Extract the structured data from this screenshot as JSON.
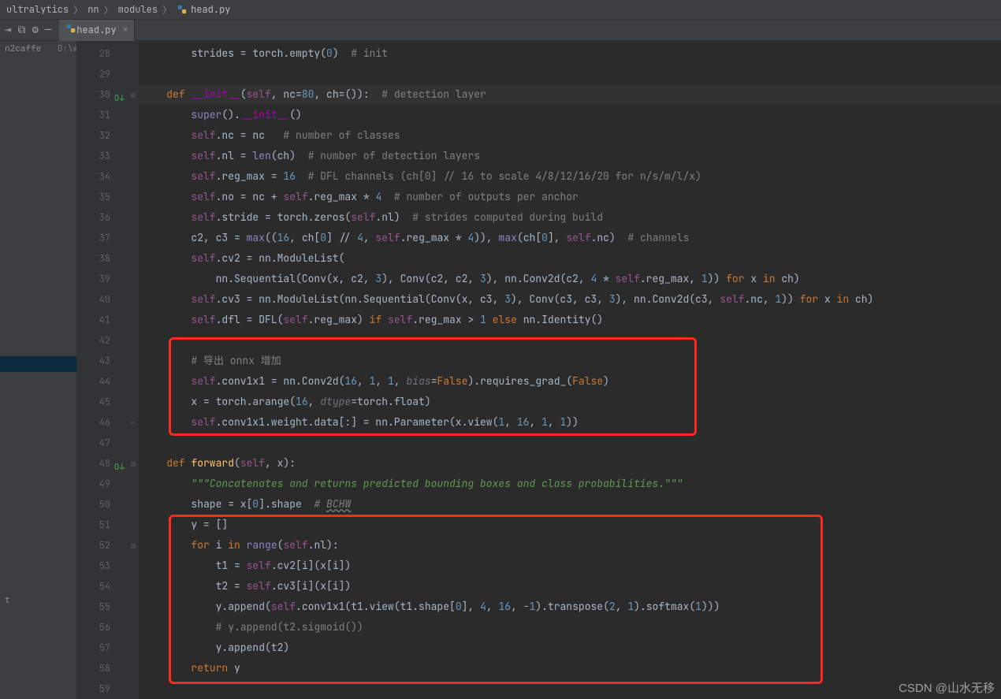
{
  "breadcrumb": {
    "p1": "ultralytics",
    "p2": "nn",
    "p3": "modules",
    "file": "head.py"
  },
  "tab": {
    "label": "head.py"
  },
  "sidebar": {
    "item0": "n2caffe",
    "item0path": "D:\\worksp",
    "item1": "t"
  },
  "lines": {
    "28": "28",
    "29": "29",
    "30": "30",
    "31": "31",
    "32": "32",
    "33": "33",
    "34": "34",
    "35": "35",
    "36": "36",
    "37": "37",
    "38": "38",
    "39": "39",
    "40": "40",
    "41": "41",
    "42": "42",
    "43": "43",
    "44": "44",
    "45": "45",
    "46": "46",
    "47": "47",
    "48": "48",
    "49": "49",
    "50": "50",
    "51": "51",
    "52": "52",
    "53": "53",
    "54": "54",
    "55": "55",
    "56": "56",
    "57": "57",
    "58": "58",
    "59": "59"
  },
  "code": {
    "l28_a": "        strides = torch.empty(",
    "l28_n": "0",
    "l28_b": ")  ",
    "l28_c": "# init",
    "l30_def": "    def ",
    "l30_fn": "__init__",
    "l30_a": "(",
    "l30_self": "self",
    "l30_b": ", nc=",
    "l30_n1": "80",
    "l30_c": ", ch=()):  ",
    "l30_cm": "# detection layer",
    "l31_a": "        ",
    "l31_b": "super",
    "l31_c": "().",
    "l31_d": "__init__",
    "l31_e": "()",
    "l32_a": "        ",
    "l32_self": "self",
    "l32_b": ".nc = nc   ",
    "l32_c": "# number of classes",
    "l33_a": "        ",
    "l33_self": "self",
    "l33_b": ".nl = ",
    "l33_len": "len",
    "l33_c": "(ch)  ",
    "l33_cm": "# number of detection layers",
    "l34_a": "        ",
    "l34_self": "self",
    "l34_b": ".reg_max = ",
    "l34_n": "16",
    "l34_c": "  ",
    "l34_cm": "# DFL channels (ch[0] // 16 to scale 4/8/12/16/20 for n/s/m/l/x)",
    "l35_a": "        ",
    "l35_self": "self",
    "l35_b": ".no = nc + ",
    "l35_self2": "self",
    "l35_c": ".reg_max * ",
    "l35_n": "4",
    "l35_d": "  ",
    "l35_cm": "# number of outputs per anchor",
    "l36_a": "        ",
    "l36_self": "self",
    "l36_b": ".stride = torch.zeros(",
    "l36_self2": "self",
    "l36_c": ".nl)  ",
    "l36_cm": "# strides computed during build",
    "l37_a": "        c2, c3 = ",
    "l37_max": "max",
    "l37_b": "((",
    "l37_n1": "16",
    "l37_c": ", ch[",
    "l37_n2": "0",
    "l37_d": "] // ",
    "l37_n3": "4",
    "l37_e": ", ",
    "l37_self": "self",
    "l37_f": ".reg_max * ",
    "l37_n4": "4",
    "l37_g": ")), ",
    "l37_max2": "max",
    "l37_h": "(ch[",
    "l37_n5": "0",
    "l37_i": "], ",
    "l37_self2": "self",
    "l37_j": ".nc)  ",
    "l37_cm": "# channels",
    "l38_a": "        ",
    "l38_self": "self",
    "l38_b": ".cv2 = nn.ModuleList(",
    "l39_a": "            nn.Sequential(Conv(x, c2, ",
    "l39_n1": "3",
    "l39_b": "), Conv(c2, c2, ",
    "l39_n2": "3",
    "l39_c": "), nn.Conv2d(c2, ",
    "l39_n3": "4",
    "l39_d": " * ",
    "l39_self": "self",
    "l39_e": ".reg_max, ",
    "l39_n4": "1",
    "l39_f": ")) ",
    "l39_for": "for ",
    "l39_g": "x ",
    "l39_in": "in ",
    "l39_h": "ch)",
    "l40_a": "        ",
    "l40_self": "self",
    "l40_b": ".cv3 = nn.ModuleList(nn.Sequential(Conv(x, c3, ",
    "l40_n1": "3",
    "l40_c": "), Conv(c3, c3, ",
    "l40_n2": "3",
    "l40_d": "), nn.Conv2d(c3, ",
    "l40_self2": "self",
    "l40_e": ".nc, ",
    "l40_n3": "1",
    "l40_f": ")) ",
    "l40_for": "for ",
    "l40_g": "x ",
    "l40_in": "in ",
    "l40_h": "ch)",
    "l41_a": "        ",
    "l41_self": "self",
    "l41_b": ".dfl = DFL(",
    "l41_self2": "self",
    "l41_c": ".reg_max) ",
    "l41_if": "if ",
    "l41_self3": "self",
    "l41_d": ".reg_max > ",
    "l41_n": "1",
    "l41_e": " ",
    "l41_else": "else ",
    "l41_f": "nn.Identity()",
    "l43_a": "        ",
    "l43_c": "# 导出 onnx 增加",
    "l44_a": "        ",
    "l44_self": "self",
    "l44_b": ".conv1x1 = nn.Conv2d(",
    "l44_n1": "16",
    "l44_c": ", ",
    "l44_n2": "1",
    "l44_d": ", ",
    "l44_n3": "1",
    "l44_e": ", ",
    "l44_kw": "bias",
    "l44_f": "=",
    "l44_false": "False",
    "l44_g": ").requires_grad_(",
    "l44_false2": "False",
    "l44_h": ")",
    "l45_a": "        x = torch.arange(",
    "l45_n": "16",
    "l45_b": ", ",
    "l45_kw": "dtype",
    "l45_c": "=torch.float)",
    "l46_a": "        ",
    "l46_self": "self",
    "l46_b": ".conv1x1.weight.data[:] = nn.Parameter(x.view(",
    "l46_n1": "1",
    "l46_c": ", ",
    "l46_n2": "16",
    "l46_d": ", ",
    "l46_n3": "1",
    "l46_e": ", ",
    "l46_n4": "1",
    "l46_f": "))",
    "l48_def": "    def ",
    "l48_fn": "forward",
    "l48_a": "(",
    "l48_self": "self",
    "l48_b": ", x):",
    "l49_a": "        ",
    "l49_doc": "\"\"\"Concatenates and returns predicted bounding boxes and class probabilities.\"\"\"",
    "l50_a": "        shape = x[",
    "l50_n": "0",
    "l50_b": "].shape  ",
    "l50_c": "# ",
    "l50_u": "BCHW",
    "l51_a": "        y = []",
    "l52_a": "        ",
    "l52_for": "for ",
    "l52_b": "i ",
    "l52_in": "in ",
    "l52_range": "range",
    "l52_c": "(",
    "l52_self": "self",
    "l52_d": ".nl):",
    "l53_a": "            t1 = ",
    "l53_self": "self",
    "l53_b": ".cv2[i](x[i])",
    "l54_a": "            t2 = ",
    "l54_self": "self",
    "l54_b": ".cv3[i](x[i])",
    "l55_a": "            y.append(",
    "l55_self": "self",
    "l55_b": ".conv1x1(t1.view(t1.shape[",
    "l55_n1": "0",
    "l55_c": "], ",
    "l55_n2": "4",
    "l55_d": ", ",
    "l55_n3": "16",
    "l55_e": ", -",
    "l55_n4": "1",
    "l55_f": ").transpose(",
    "l55_n5": "2",
    "l55_g": ", ",
    "l55_n6": "1",
    "l55_h": ").softmax(",
    "l55_n7": "1",
    "l55_i": ")))",
    "l56_a": "            ",
    "l56_c": "# y.append(t2.sigmoid())",
    "l57_a": "            y.append(t2)",
    "l58_a": "        ",
    "l58_ret": "return ",
    "l58_b": "y"
  },
  "watermark": "CSDN @山水无移"
}
